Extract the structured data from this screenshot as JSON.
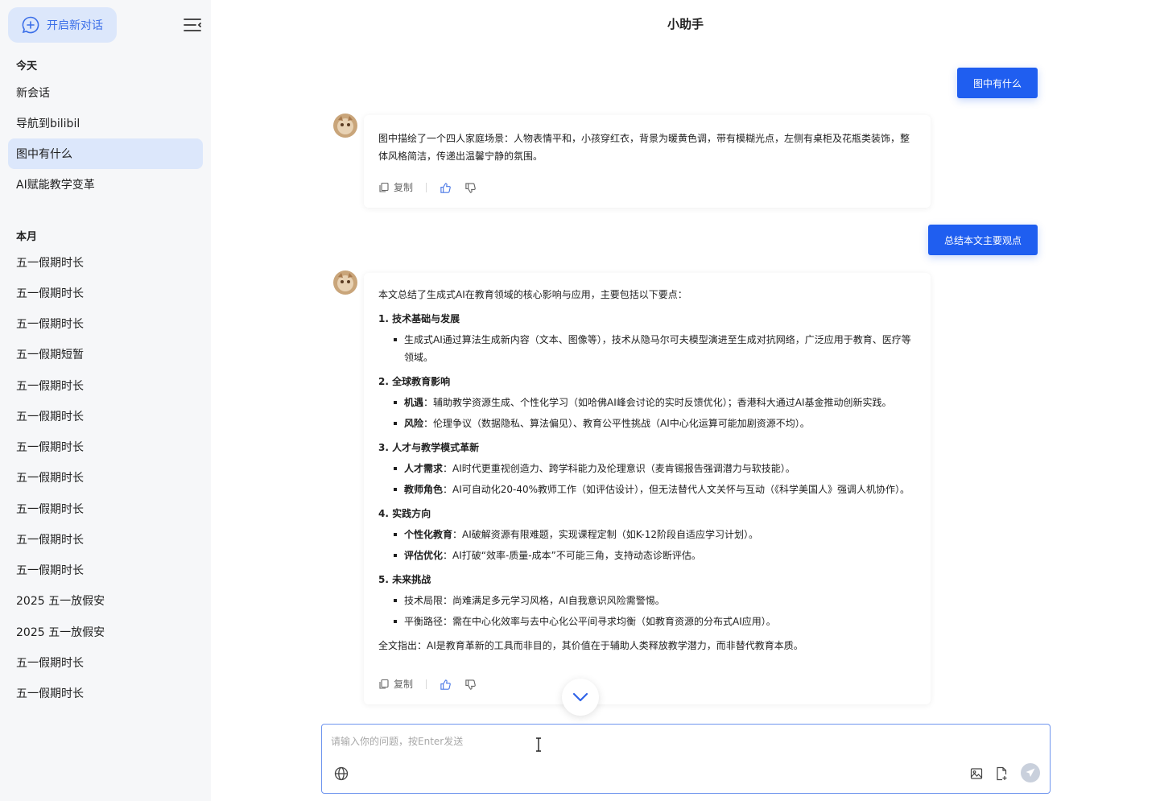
{
  "sidebar": {
    "new_chat_label": "开启新对话",
    "today_title": "今天",
    "today_items": [
      "新会话",
      "导航到bilibil",
      "图中有什么",
      "AI赋能教学变革"
    ],
    "month_title": "本月",
    "month_items": [
      "五一假期时长",
      "五一假期时长",
      "五一假期时长",
      "五一假期短暂",
      "五一假期时长",
      "五一假期时长",
      "五一假期时长",
      "五一假期时长",
      "五一假期时长",
      "五一假期时长",
      "五一假期时长",
      "2025 五一放假安",
      "2025 五一放假安",
      "五一假期时长",
      "五一假期时长"
    ]
  },
  "header": {
    "title": "小助手"
  },
  "messages": {
    "user1": "图中有什么",
    "bot1": "图中描绘了一个四人家庭场景：人物表情平和，小孩穿红衣，背景为暖黄色调，带有模糊光点，左侧有桌柜及花瓶类装饰，整体风格简洁，传递出温馨宁静的氛围。",
    "user2": "总结本文主要观点",
    "bot2": {
      "intro": "本文总结了生成式AI在教育领域的核心影响与应用，主要包括以下要点：",
      "h1": "1. 技术基础与发展",
      "h1_b1": "生成式AI通过算法生成新内容（文本、图像等），技术从隐马尔可夫模型演进至生成对抗网络，广泛应用于教育、医疗等领域。",
      "h2": "2. 全球教育影响",
      "h2_b1_label": "机遇",
      "h2_b1_text": "：辅助教学资源生成、个性化学习（如哈佛AI峰会讨论的实时反馈优化）；香港科大通过AI基金推动创新实践。",
      "h2_b2_label": "风险",
      "h2_b2_text": "：伦理争议（数据隐私、算法偏见）、教育公平性挑战（AI中心化运算可能加剧资源不均）。",
      "h3": "3. 人才与教学模式革新",
      "h3_b1_label": "人才需求",
      "h3_b1_text": "：AI时代更重视创造力、跨学科能力及伦理意识（麦肯锡报告强调潜力与软技能）。",
      "h3_b2_label": "教师角色",
      "h3_b2_text": "：AI可自动化20-40%教师工作（如评估设计），但无法替代人文关怀与互动（《科学美国人》强调人机协作）。",
      "h4": "4. 实践方向",
      "h4_b1_label": "个性化教育",
      "h4_b1_text": "：AI破解资源有限难题，实现课程定制（如K-12阶段自适应学习计划）。",
      "h4_b2_label": "评估优化",
      "h4_b2_text": "：AI打破“效率-质量-成本”不可能三角，支持动态诊断评估。",
      "h5": "5. 未来挑战",
      "h5_b1": "技术局限：尚难满足多元学习风格，AI自我意识风险需警惕。",
      "h5_b2": "平衡路径：需在中心化效率与去中心化公平间寻求均衡（如教育资源的分布式AI应用）。",
      "conclusion": "全文指出：AI是教育革新的工具而非目的，其价值在于辅助人类释放教学潜力，而非替代教育本质。"
    },
    "copy_label": "复制"
  },
  "composer": {
    "placeholder": "请输入你的问题，按Enter发送"
  },
  "colors": {
    "accent": "#1f5ef0",
    "sidebar_bg": "#f6f7f9",
    "active_bg": "#dce7fb"
  }
}
